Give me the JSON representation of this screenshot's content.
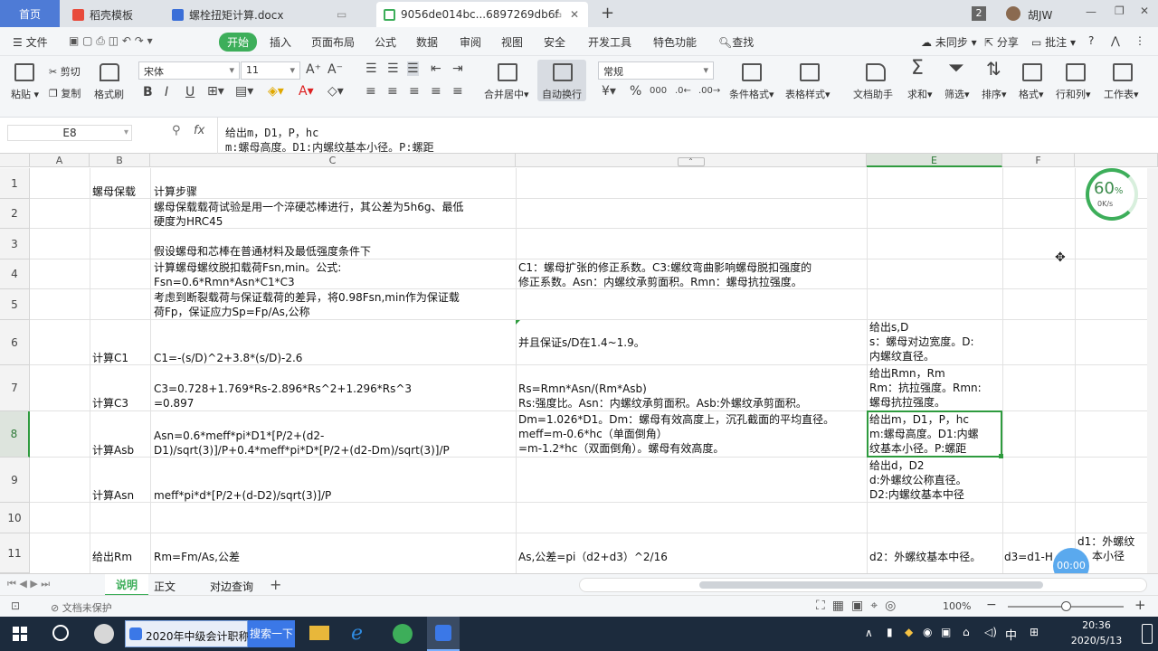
{
  "tabs": {
    "home": "首页",
    "t1": "稻壳模板",
    "t2": "螺栓扭矩计算.docx",
    "t3": "9056de014bc...6897269db6f",
    "badge": "2",
    "user": "胡JW"
  },
  "menu": {
    "file": "文件",
    "items": [
      "开始",
      "插入",
      "页面布局",
      "公式",
      "数据",
      "审阅",
      "视图",
      "安全",
      "开发工具",
      "特色功能"
    ],
    "search": "查找",
    "sync": "未同步",
    "share": "分享",
    "comment": "批注",
    "help": "?"
  },
  "ribbon": {
    "paste": "粘贴",
    "cut": "剪切",
    "copy": "复制",
    "format_painter": "格式刷",
    "font": "宋体",
    "size": "11",
    "merge": "合并居中",
    "wrap": "自动换行",
    "number_format": "常规",
    "percent": "%",
    "cond_format": "条件格式",
    "table_style": "表格样式",
    "doc_assist": "文档助手",
    "sum": "求和",
    "filter": "筛选",
    "sort": "排序",
    "format": "格式",
    "rowcol": "行和列",
    "sheet": "工作表"
  },
  "formula": {
    "namebox": "E8",
    "fx": "fx",
    "line1": "给出m，D1，P，hc",
    "line2": "m:螺母高度。D1:内螺纹基本小径。P:螺距"
  },
  "columns": [
    "A",
    "B",
    "C",
    "D",
    "E",
    "F"
  ],
  "rows": [
    "1",
    "2",
    "3",
    "4",
    "5",
    "6",
    "7",
    "8",
    "9",
    "10",
    "11"
  ],
  "cells": {
    "b1": "螺母保载",
    "c1": "计算步骤",
    "c2a": "螺母保载载荷试验是用一个淬硬芯棒进行，其公差为5h6g、最低",
    "c2b": "硬度为HRC45",
    "c3": "假设螺母和芯棒在普通材料及最低强度条件下",
    "c4a": "计算螺母螺纹脱扣载荷Fsn,min。公式:",
    "c4b": "Fsn=0.6*Rmn*Asn*C1*C3",
    "d4a": "C1：螺母扩张的修正系数。C3:螺纹弯曲影响螺母脱扣强度的",
    "d4b": "修正系数。Asn：内螺纹承剪面积。Rmn：螺母抗拉强度。",
    "c5a": "考虑到断裂载荷与保证载荷的差异，将0.98Fsn,min作为保证载",
    "c5b": "荷Fp，保证应力Sp=Fp/As,公称",
    "b6": "计算C1",
    "c6": "C1=-(s/D)^2+3.8*(s/D)-2.6",
    "d6": "并且保证s/D在1.4~1.9。",
    "e6a": "给出s,D",
    "e6b": "s：螺母对边宽度。D:",
    "e6c": "内螺纹直径。",
    "b7": "计算C3",
    "c7a": "C3=0.728+1.769*Rs-2.896*Rs^2+1.296*Rs^3",
    "c7b": "=0.897",
    "d7a": "Rs=Rmn*Asn/(Rm*Asb)",
    "d7b": "Rs:强度比。Asn：内螺纹承剪面积。Asb:外螺纹承剪面积。",
    "e7a": "给出Rmn，Rm",
    "e7b": "Rm：抗拉强度。Rmn:",
    "e7c": "螺母抗拉强度。",
    "b8": "计算Asb",
    "c8a": "Asn=0.6*meff*pi*D1*[P/2+(d2-",
    "c8b": "D1)/sqrt(3)]/P+0.4*meff*pi*D*[P/2+(d2-Dm)/sqrt(3)]/P",
    "d8a": "Dm=1.026*D1。Dm：螺母有效高度上，沉孔截面的平均直径。",
    "d8b": "meff=m-0.6*hc（单面倒角）",
    "d8c": "=m-1.2*hc（双面倒角）。螺母有效高度。",
    "e8a": "给出m，D1，P，hc",
    "e8b": "m:螺母高度。D1:内螺",
    "e8c": "纹基本小径。P:螺距",
    "b9": "计算Asn",
    "c9": "meff*pi*d*[P/2+(d-D2)/sqrt(3)]/P",
    "e9a": "给出d，D2",
    "e9b": "d:外螺纹公称直径。",
    "e9c": "D2:内螺纹基本中径",
    "b11": "给出Rm",
    "c11": "Rm=Fm/As,公差",
    "d11": "As,公差=pi（d2+d3）^2/16",
    "e11": "d2：外螺纹基本中径。",
    "f11": "d3=d1-H",
    "g11a": "d1：外螺纹",
    "g11b": "本小径"
  },
  "speed": {
    "pct": "60",
    "unit": "%",
    "rate": "0K/s"
  },
  "sheets": [
    "说明",
    "正文",
    "对边查询"
  ],
  "status": {
    "protect": "文档未保护",
    "zoom": "100%",
    "timer": "00:00"
  },
  "taskbar": {
    "app1": "2020年中级会计职称",
    "search": "搜索一下",
    "ime": "中",
    "time": "20:36",
    "date": "2020/5/13"
  },
  "colors": {
    "accent": "#3dae5a",
    "selection": "#2e9b3e",
    "taskbar": "#1c2b3d",
    "tabhome": "#4e7bd6"
  }
}
